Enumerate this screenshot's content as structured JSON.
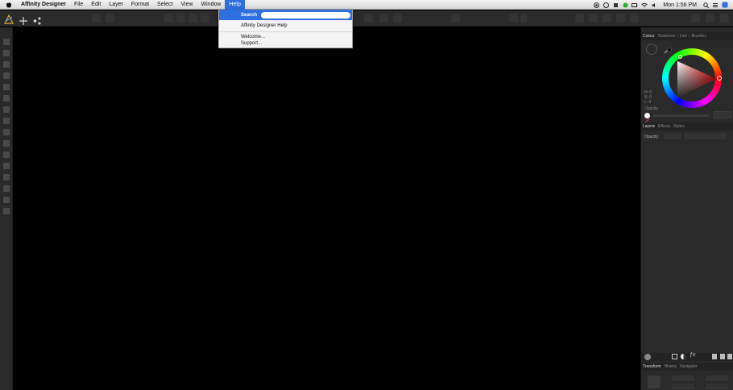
{
  "menubar": {
    "app_name": "Affinity Designer",
    "menus": [
      "File",
      "Edit",
      "Layer",
      "Format",
      "Select",
      "View",
      "Window",
      "Help"
    ],
    "clock": "Mon 1:56 PM",
    "status_icons": [
      "record-icon",
      "sync-icon",
      "time-machine-icon",
      "evernote-icon",
      "wifi-icon",
      "volume-icon"
    ]
  },
  "help_menu": {
    "search_label": "Search",
    "search_value": "",
    "items": [
      "Affinity Designer Help",
      "Welcome...",
      "Support..."
    ]
  },
  "panels": {
    "colour_tabs": [
      "Colour",
      "Swatches",
      "Line",
      "Brushes"
    ],
    "hsl": [
      "H: 0",
      "S: 0",
      "L: 0"
    ],
    "opacity_label": "Opacity",
    "layer_tabs": [
      "Layers",
      "Effects",
      "Styles"
    ],
    "layer_opacity_label": "Opacity:",
    "transform_tabs": [
      "Transform",
      "History",
      "Navigator"
    ]
  },
  "colors": {
    "menu_highlight": "#2f6fe0",
    "toolbar_bg": "#2b2b2b",
    "panel_bg": "#2a2a2a",
    "canvas_bg": "#000000"
  }
}
